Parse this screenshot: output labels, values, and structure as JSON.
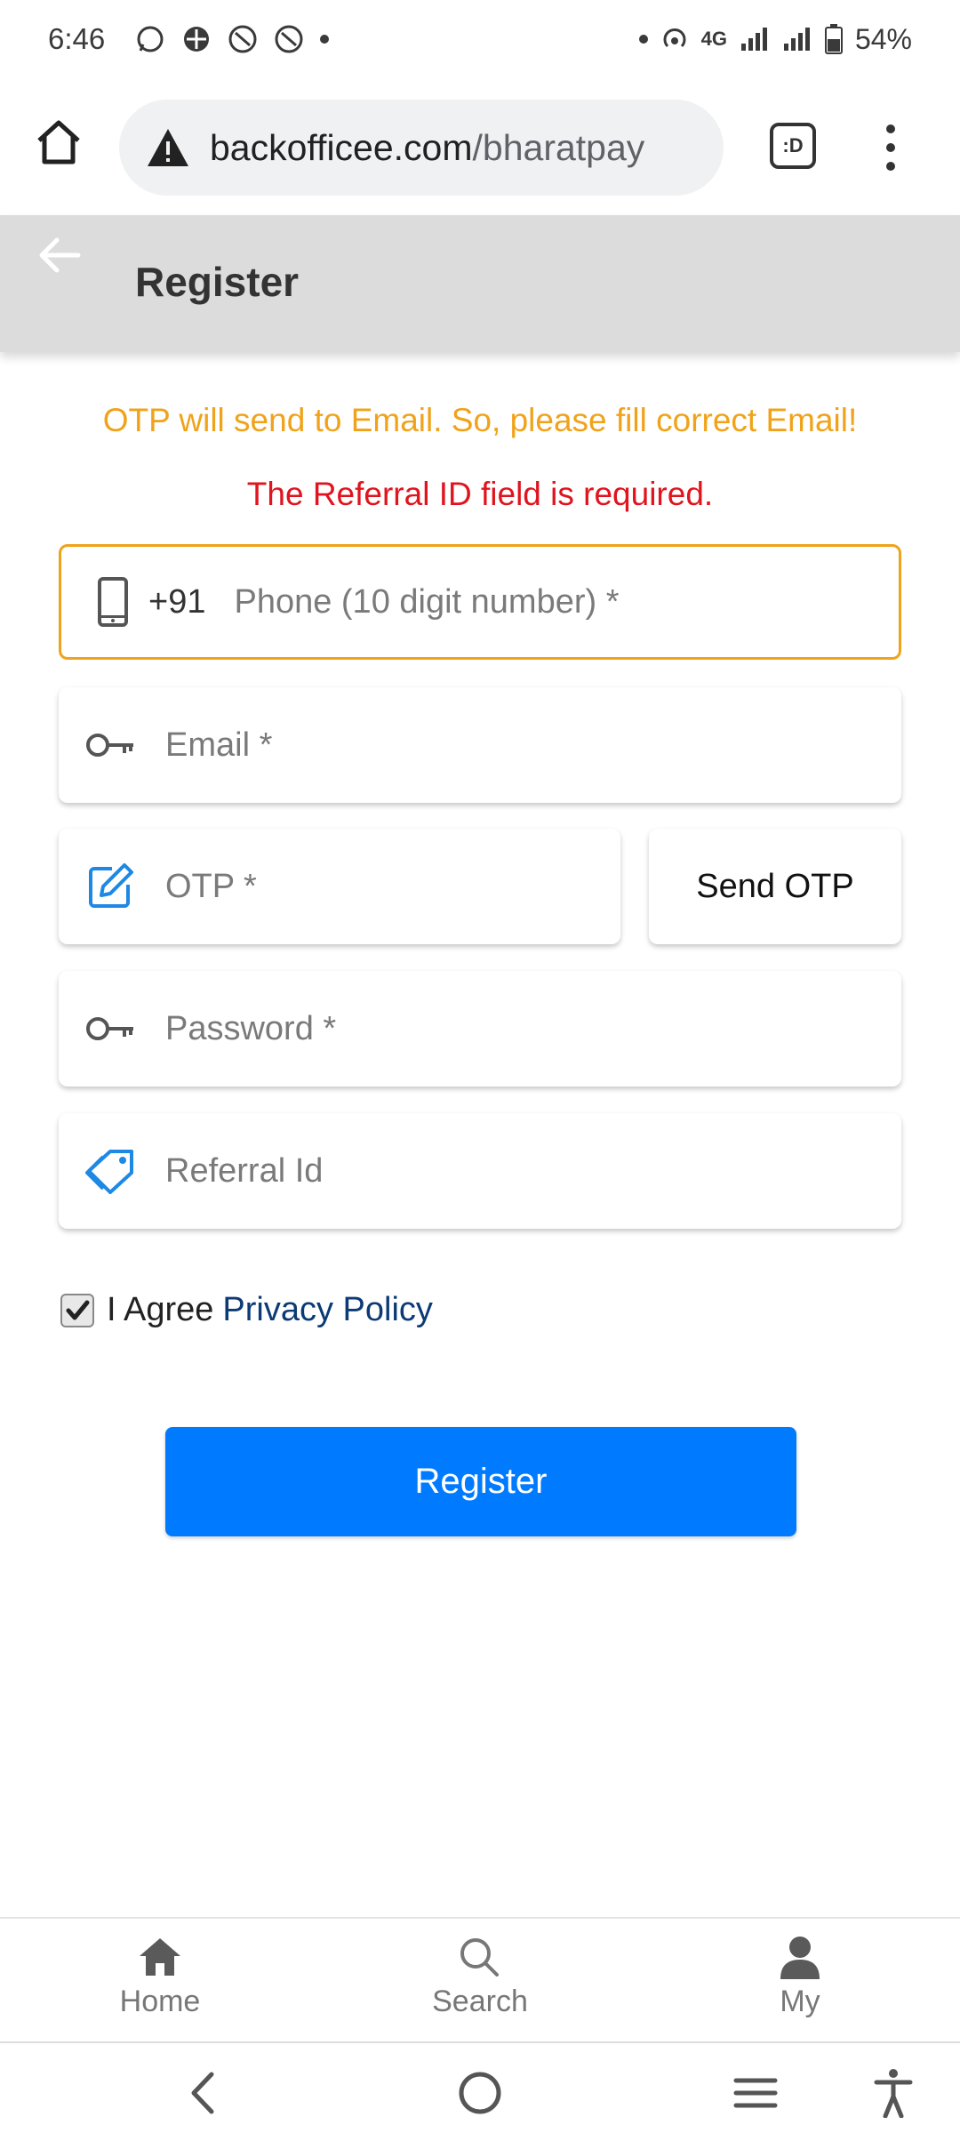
{
  "status_bar": {
    "time": "6:46",
    "network": "4G",
    "battery": "54%"
  },
  "browser": {
    "url_host": "backofficee.com",
    "url_path": "/bharatpay",
    "tab_label": ":D"
  },
  "header": {
    "title": "Register"
  },
  "messages": {
    "warning": "OTP will send to Email. So, please fill correct Email!",
    "error": "The Referral ID field is required."
  },
  "form": {
    "phone": {
      "prefix": "+91",
      "placeholder": "Phone (10 digit number) *",
      "value": ""
    },
    "email": {
      "placeholder": "Email *",
      "value": ""
    },
    "otp": {
      "placeholder": "OTP *",
      "value": ""
    },
    "send_otp_label": "Send OTP",
    "password": {
      "placeholder": "Password *",
      "value": ""
    },
    "referral": {
      "placeholder": "Referral Id",
      "value": ""
    },
    "agree_text": "I Agree",
    "agree_link": "Privacy Policy",
    "agree_checked": true,
    "submit_label": "Register"
  },
  "bottom_nav": {
    "items": [
      {
        "label": "Home",
        "icon": "home-icon"
      },
      {
        "label": "Search",
        "icon": "search-icon"
      },
      {
        "label": "My",
        "icon": "user-icon"
      }
    ]
  },
  "colors": {
    "primary": "#007bff",
    "warning": "#f0a31a",
    "error": "#e0141e",
    "link": "#0b3a75",
    "icon_blue": "#1e88e5"
  }
}
